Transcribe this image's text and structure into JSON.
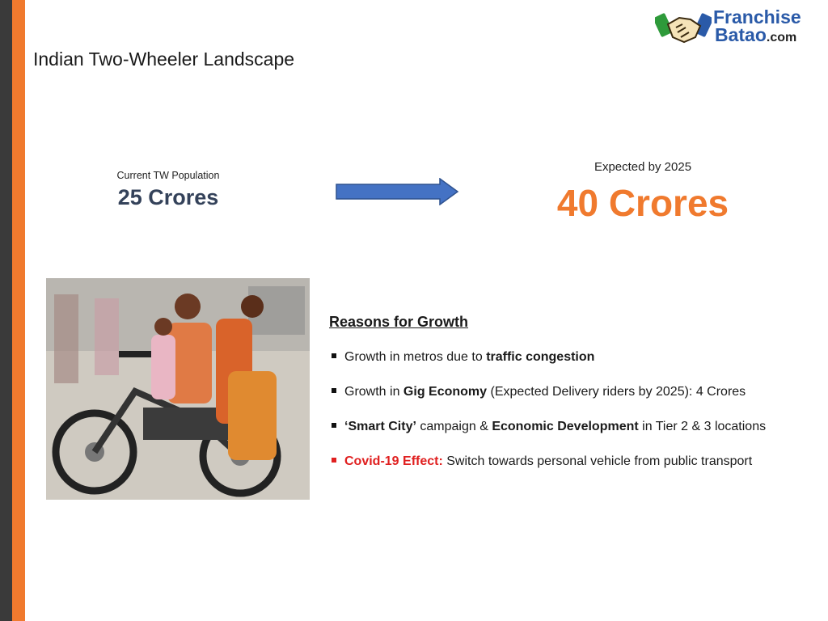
{
  "slide": {
    "title": "Indian Two-Wheeler Landscape"
  },
  "logo": {
    "line1": "Franchise",
    "line2": "Batao",
    "suffix": ".com",
    "icon": "handshake-icon",
    "brand_color": "#2a5aa8"
  },
  "stats": {
    "current_label": "Current TW Population",
    "current_value": "25 Crores",
    "expected_label": "Expected by 2025",
    "expected_value": "40 Crores",
    "arrow_icon": "right-arrow-icon",
    "accent_color": "#f07a2e"
  },
  "photo": {
    "subject": "family-riding-motorcycle-photo"
  },
  "reasons": {
    "heading": "Reasons for Growth",
    "items": [
      {
        "pre": "Growth in metros due to ",
        "bold": "traffic congestion",
        "post": ""
      },
      {
        "pre": "Growth in ",
        "bold": "Gig Economy",
        "post": " (Expected Delivery riders by 2025): 4 Crores"
      },
      {
        "bold1": "‘Smart City’",
        "mid": " campaign & ",
        "bold2": "Economic Development",
        "post": " in Tier 2 & 3 locations"
      },
      {
        "bold": "Covid-19 Effect:",
        "post": " Switch towards personal vehicle from public transport"
      }
    ]
  }
}
